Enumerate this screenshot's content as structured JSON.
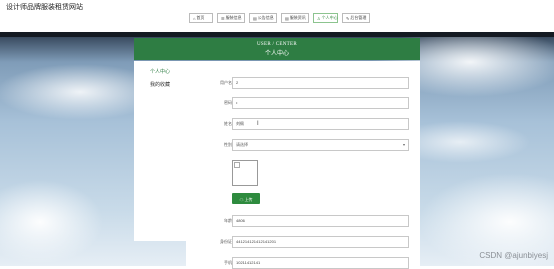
{
  "site": {
    "title": "设计师品牌服装租赁网站"
  },
  "nav": [
    {
      "label": "首页",
      "icon": "home-icon",
      "glyph": "⌂"
    },
    {
      "label": "服装信息",
      "icon": "list-icon",
      "glyph": "☰"
    },
    {
      "label": "公告信息",
      "icon": "doc-icon",
      "glyph": "▤"
    },
    {
      "label": "服装资讯",
      "icon": "news-icon",
      "glyph": "▤"
    },
    {
      "label": "个人中心",
      "icon": "user-icon",
      "glyph": "♙"
    },
    {
      "label": "后台管理",
      "icon": "wrench-icon",
      "glyph": "✎"
    }
  ],
  "header": {
    "en": "USER / CENTER",
    "zh": "个人中心"
  },
  "sidebar": {
    "items": [
      {
        "label": "个人中心"
      },
      {
        "label": "我的收藏"
      }
    ]
  },
  "form": {
    "username": {
      "label": "用户名",
      "value": "2"
    },
    "password": {
      "label": "密码",
      "value": "•"
    },
    "name": {
      "label": "姓名",
      "value": "刘佩"
    },
    "gender": {
      "label": "性别",
      "value": "请选择"
    },
    "upload_label": "上传图片",
    "age": {
      "label": "年龄",
      "value": "4806"
    },
    "idcard": {
      "label": "身份证",
      "value": "441214121412141201"
    },
    "phone": {
      "label": "手机",
      "value": "10211412141"
    }
  },
  "watermark": "CSDN @ajunbiyesj",
  "colors": {
    "accent": "#2e7d43"
  }
}
